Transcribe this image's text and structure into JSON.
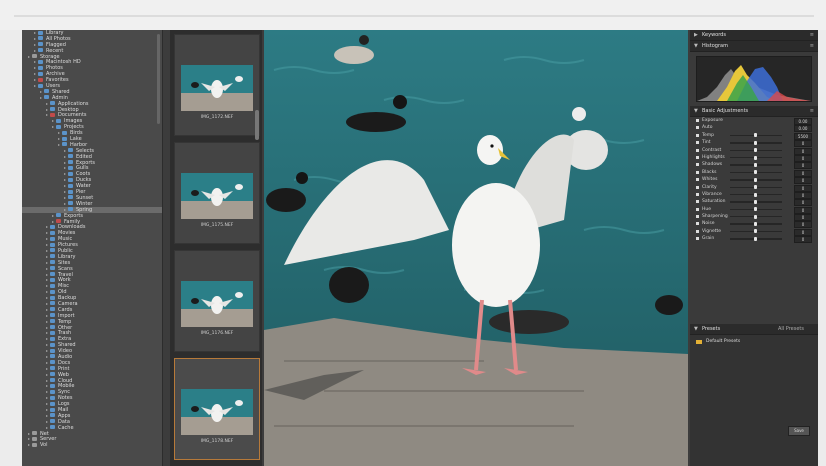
{
  "tree": {
    "rows": [
      {
        "indent": 1,
        "icon": "folder",
        "label": "Library"
      },
      {
        "indent": 1,
        "icon": "folder",
        "label": "All Photos"
      },
      {
        "indent": 1,
        "icon": "folder",
        "label": "Flagged"
      },
      {
        "indent": 1,
        "icon": "folder",
        "label": "Recent"
      },
      {
        "indent": 0,
        "icon": "disk",
        "label": "Storage"
      },
      {
        "indent": 1,
        "icon": "folder",
        "label": "Macintosh HD"
      },
      {
        "indent": 1,
        "icon": "folder",
        "label": "Photos"
      },
      {
        "indent": 1,
        "icon": "folder",
        "label": "Archive"
      },
      {
        "indent": 1,
        "icon": "red",
        "label": "Favorites"
      },
      {
        "indent": 1,
        "icon": "folder",
        "label": "Users"
      },
      {
        "indent": 2,
        "icon": "folder",
        "label": "Shared"
      },
      {
        "indent": 2,
        "icon": "folder",
        "label": "Admin"
      },
      {
        "indent": 3,
        "icon": "folder",
        "label": "Applications"
      },
      {
        "indent": 3,
        "icon": "folder",
        "label": "Desktop"
      },
      {
        "indent": 3,
        "icon": "red",
        "label": "Documents"
      },
      {
        "indent": 4,
        "icon": "folder",
        "label": "Images"
      },
      {
        "indent": 4,
        "icon": "folder",
        "label": "Projects"
      },
      {
        "indent": 5,
        "icon": "folder",
        "label": "Birds"
      },
      {
        "indent": 5,
        "icon": "folder",
        "label": "Lake"
      },
      {
        "indent": 5,
        "icon": "folder",
        "label": "Harbor"
      },
      {
        "indent": 6,
        "icon": "folder",
        "label": "Selects"
      },
      {
        "indent": 6,
        "icon": "folder",
        "label": "Edited"
      },
      {
        "indent": 6,
        "icon": "folder",
        "label": "Exports"
      },
      {
        "indent": 6,
        "icon": "folder",
        "label": "Gulls"
      },
      {
        "indent": 6,
        "icon": "folder",
        "label": "Coots"
      },
      {
        "indent": 6,
        "icon": "folder",
        "label": "Ducks"
      },
      {
        "indent": 6,
        "icon": "folder",
        "label": "Water"
      },
      {
        "indent": 6,
        "icon": "folder",
        "label": "Pier"
      },
      {
        "indent": 6,
        "icon": "folder",
        "label": "Sunset"
      },
      {
        "indent": 6,
        "icon": "folder",
        "label": "Winter"
      },
      {
        "indent": 6,
        "icon": "folder",
        "label": "Spring",
        "selected": true
      },
      {
        "indent": 4,
        "icon": "folder",
        "label": "Exports"
      },
      {
        "indent": 4,
        "icon": "red",
        "label": "Family"
      },
      {
        "indent": 3,
        "icon": "folder",
        "label": "Downloads"
      },
      {
        "indent": 3,
        "icon": "folder",
        "label": "Movies"
      },
      {
        "indent": 3,
        "icon": "folder",
        "label": "Music"
      },
      {
        "indent": 3,
        "icon": "folder",
        "label": "Pictures"
      },
      {
        "indent": 3,
        "icon": "folder",
        "label": "Public"
      },
      {
        "indent": 3,
        "icon": "folder",
        "label": "Library"
      },
      {
        "indent": 3,
        "icon": "folder",
        "label": "Sites"
      },
      {
        "indent": 3,
        "icon": "folder",
        "label": "Scans"
      },
      {
        "indent": 3,
        "icon": "folder",
        "label": "Travel"
      },
      {
        "indent": 3,
        "icon": "folder",
        "label": "Work"
      },
      {
        "indent": 3,
        "icon": "folder",
        "label": "Misc"
      },
      {
        "indent": 3,
        "icon": "folder",
        "label": "Old"
      },
      {
        "indent": 3,
        "icon": "folder",
        "label": "Backup"
      },
      {
        "indent": 3,
        "icon": "folder",
        "label": "Camera"
      },
      {
        "indent": 3,
        "icon": "folder",
        "label": "Cards"
      },
      {
        "indent": 3,
        "icon": "folder",
        "label": "Import"
      },
      {
        "indent": 3,
        "icon": "folder",
        "label": "Temp"
      },
      {
        "indent": 3,
        "icon": "folder",
        "label": "Other"
      },
      {
        "indent": 3,
        "icon": "folder",
        "label": "Trash"
      },
      {
        "indent": 3,
        "icon": "folder",
        "label": "Extra"
      },
      {
        "indent": 3,
        "icon": "folder",
        "label": "Shared"
      },
      {
        "indent": 3,
        "icon": "folder",
        "label": "Video"
      },
      {
        "indent": 3,
        "icon": "folder",
        "label": "Audio"
      },
      {
        "indent": 3,
        "icon": "folder",
        "label": "Docs"
      },
      {
        "indent": 3,
        "icon": "folder",
        "label": "Print"
      },
      {
        "indent": 3,
        "icon": "folder",
        "label": "Web"
      },
      {
        "indent": 3,
        "icon": "folder",
        "label": "Cloud"
      },
      {
        "indent": 3,
        "icon": "folder",
        "label": "Mobile"
      },
      {
        "indent": 3,
        "icon": "folder",
        "label": "Sync"
      },
      {
        "indent": 3,
        "icon": "folder",
        "label": "Notes"
      },
      {
        "indent": 3,
        "icon": "folder",
        "label": "Logs"
      },
      {
        "indent": 3,
        "icon": "folder",
        "label": "Mail"
      },
      {
        "indent": 3,
        "icon": "folder",
        "label": "Apps"
      },
      {
        "indent": 3,
        "icon": "folder",
        "label": "Data"
      },
      {
        "indent": 3,
        "icon": "folder",
        "label": "Cache"
      },
      {
        "indent": 0,
        "icon": "disk",
        "label": "Net"
      },
      {
        "indent": 0,
        "icon": "disk",
        "label": "Server"
      },
      {
        "indent": 0,
        "icon": "disk",
        "label": "Vol"
      }
    ]
  },
  "thumbs": [
    {
      "caption": "IMG_1172.NEF",
      "active": false
    },
    {
      "caption": "IMG_1175.NEF",
      "active": false
    },
    {
      "caption": "IMG_1176.NEF",
      "active": false
    },
    {
      "caption": "IMG_1178.NEF",
      "active": true
    }
  ],
  "panel": {
    "sections": {
      "keywords": "Keywords",
      "histogram": "Histogram",
      "basic": "Basic Adjustments",
      "presets": "Presets"
    },
    "preset_dropdown": "All Presets",
    "preset_items": [
      "Default Presets"
    ],
    "preset_button": "Save",
    "rows": [
      {
        "name": "Exposure",
        "value": "0.00",
        "kind": "top"
      },
      {
        "name": "Auto",
        "value": "0.00",
        "kind": "top"
      },
      {
        "name": "Temp",
        "value": "5500",
        "kind": "slider"
      },
      {
        "name": "Tint",
        "value": "0",
        "kind": "slider"
      },
      {
        "name": "Contrast",
        "value": "0",
        "kind": "slider"
      },
      {
        "name": "Highlights",
        "value": "0",
        "kind": "slider"
      },
      {
        "name": "Shadows",
        "value": "0",
        "kind": "slider"
      },
      {
        "name": "Blacks",
        "value": "0",
        "kind": "slider"
      },
      {
        "name": "Whites",
        "value": "0",
        "kind": "slider"
      },
      {
        "name": "Clarity",
        "value": "0",
        "kind": "slider"
      },
      {
        "name": "Vibrance",
        "value": "0",
        "kind": "slider"
      },
      {
        "name": "Saturation",
        "value": "0",
        "kind": "slider"
      },
      {
        "name": "Hue",
        "value": "0",
        "kind": "slider"
      },
      {
        "name": "Sharpening",
        "value": "0",
        "kind": "slider"
      },
      {
        "name": "Noise",
        "value": "0",
        "kind": "slider"
      },
      {
        "name": "Vignette",
        "value": "0",
        "kind": "slider"
      },
      {
        "name": "Grain",
        "value": "0",
        "kind": "slider"
      }
    ]
  },
  "colors": {
    "water": "#2a6f75",
    "accent": "#b77a3a",
    "folder": "#5b93c9",
    "folder_red": "#c04b4b"
  }
}
